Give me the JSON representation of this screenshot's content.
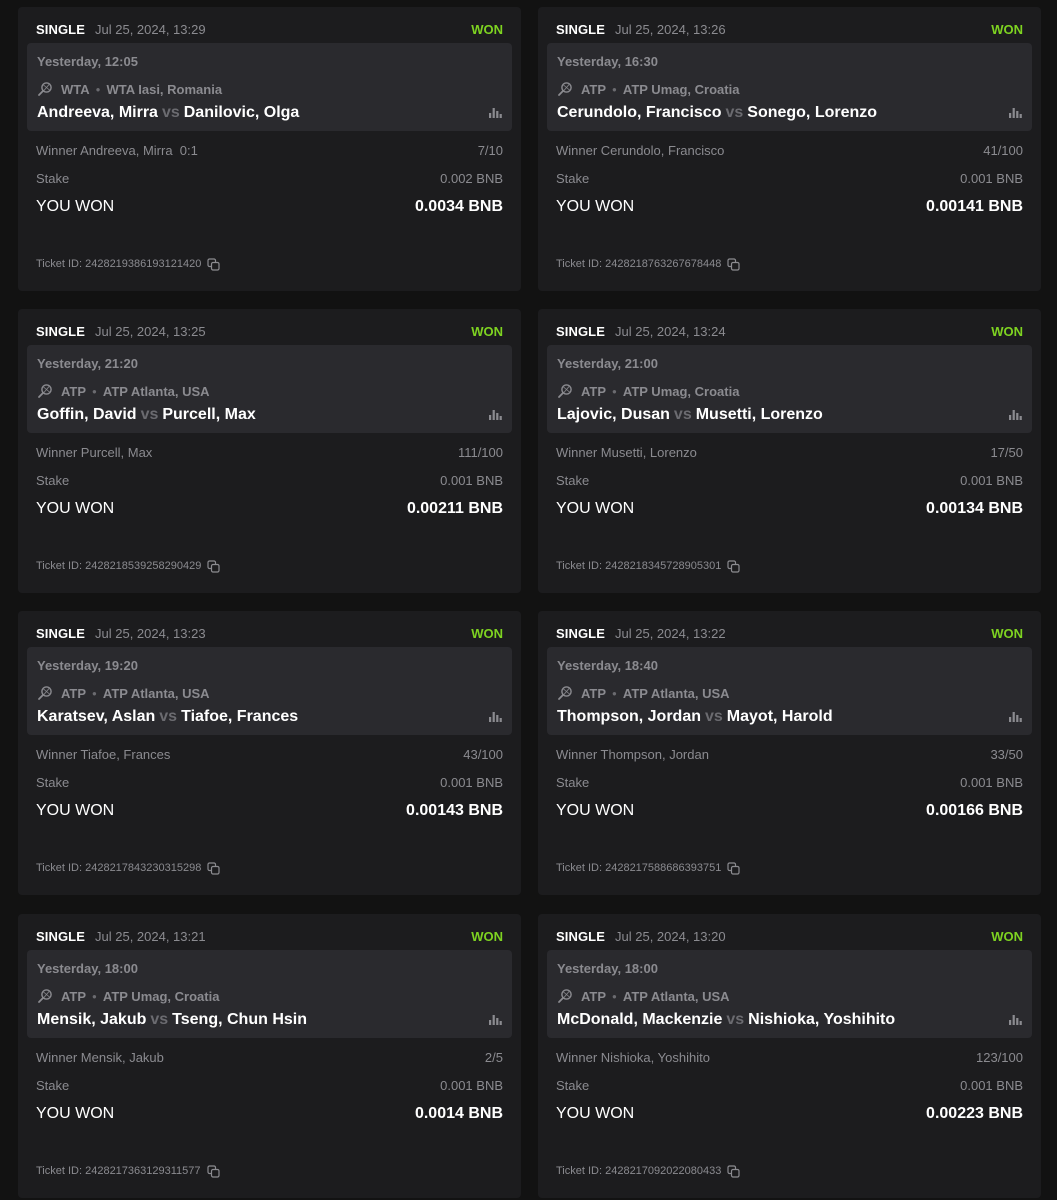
{
  "colors": {
    "won": "#7ed321",
    "muted": "#8b8b90",
    "card_bg": "#1c1c1e",
    "event_bg": "#2a2a2e"
  },
  "tickets": [
    {
      "type": "SINGLE",
      "placed": "Jul 25, 2024, 13:29",
      "status": "WON",
      "event_time": "Yesterday, 12:05",
      "sport_icon": "tennis-racket-icon",
      "tour": "WTA",
      "tournament": "WTA Iasi, Romania",
      "home": "Andreeva, Mirra",
      "vs": "vs",
      "away": "Danilovic, Olga",
      "selection": "Winner Andreeva, Mirra  0:1",
      "odds": "7/10",
      "stake_label": "Stake",
      "stake": "0.002 BNB",
      "won_label": "YOU WON",
      "won": "0.0034 BNB",
      "ticket_id": "Ticket ID: 2428219386193121420"
    },
    {
      "type": "SINGLE",
      "placed": "Jul 25, 2024, 13:26",
      "status": "WON",
      "event_time": "Yesterday, 16:30",
      "sport_icon": "tennis-racket-icon",
      "tour": "ATP",
      "tournament": "ATP Umag, Croatia",
      "home": "Cerundolo, Francisco",
      "vs": "vs",
      "away": "Sonego, Lorenzo",
      "selection": "Winner Cerundolo, Francisco",
      "odds": "41/100",
      "stake_label": "Stake",
      "stake": "0.001 BNB",
      "won_label": "YOU WON",
      "won": "0.00141 BNB",
      "ticket_id": "Ticket ID: 2428218763267678448"
    },
    {
      "type": "SINGLE",
      "placed": "Jul 25, 2024, 13:25",
      "status": "WON",
      "event_time": "Yesterday, 21:20",
      "sport_icon": "tennis-racket-icon",
      "tour": "ATP",
      "tournament": "ATP Atlanta, USA",
      "home": "Goffin, David",
      "vs": "vs",
      "away": "Purcell, Max",
      "selection": "Winner Purcell, Max",
      "odds": "111/100",
      "stake_label": "Stake",
      "stake": "0.001 BNB",
      "won_label": "YOU WON",
      "won": "0.00211 BNB",
      "ticket_id": "Ticket ID: 2428218539258290429"
    },
    {
      "type": "SINGLE",
      "placed": "Jul 25, 2024, 13:24",
      "status": "WON",
      "event_time": "Yesterday, 21:00",
      "sport_icon": "tennis-racket-icon",
      "tour": "ATP",
      "tournament": "ATP Umag, Croatia",
      "home": "Lajovic, Dusan",
      "vs": "vs",
      "away": "Musetti, Lorenzo",
      "selection": "Winner Musetti, Lorenzo",
      "odds": "17/50",
      "stake_label": "Stake",
      "stake": "0.001 BNB",
      "won_label": "YOU WON",
      "won": "0.00134 BNB",
      "ticket_id": "Ticket ID: 2428218345728905301"
    },
    {
      "type": "SINGLE",
      "placed": "Jul 25, 2024, 13:23",
      "status": "WON",
      "event_time": "Yesterday, 19:20",
      "sport_icon": "tennis-racket-icon",
      "tour": "ATP",
      "tournament": "ATP Atlanta, USA",
      "home": "Karatsev, Aslan",
      "vs": "vs",
      "away": "Tiafoe, Frances",
      "selection": "Winner Tiafoe, Frances",
      "odds": "43/100",
      "stake_label": "Stake",
      "stake": "0.001 BNB",
      "won_label": "YOU WON",
      "won": "0.00143 BNB",
      "ticket_id": "Ticket ID: 2428217843230315298"
    },
    {
      "type": "SINGLE",
      "placed": "Jul 25, 2024, 13:22",
      "status": "WON",
      "event_time": "Yesterday, 18:40",
      "sport_icon": "tennis-racket-icon",
      "tour": "ATP",
      "tournament": "ATP Atlanta, USA",
      "home": "Thompson, Jordan",
      "vs": "vs",
      "away": "Mayot, Harold",
      "selection": "Winner Thompson, Jordan",
      "odds": "33/50",
      "stake_label": "Stake",
      "stake": "0.001 BNB",
      "won_label": "YOU WON",
      "won": "0.00166 BNB",
      "ticket_id": "Ticket ID: 2428217588686393751"
    },
    {
      "type": "SINGLE",
      "placed": "Jul 25, 2024, 13:21",
      "status": "WON",
      "event_time": "Yesterday, 18:00",
      "sport_icon": "tennis-racket-icon",
      "tour": "ATP",
      "tournament": "ATP Umag, Croatia",
      "home": "Mensik, Jakub",
      "vs": "vs",
      "away": "Tseng, Chun Hsin",
      "selection": "Winner Mensik, Jakub",
      "odds": "2/5",
      "stake_label": "Stake",
      "stake": "0.001 BNB",
      "won_label": "YOU WON",
      "won": "0.0014 BNB",
      "ticket_id": "Ticket ID: 2428217363129311577"
    },
    {
      "type": "SINGLE",
      "placed": "Jul 25, 2024, 13:20",
      "status": "WON",
      "event_time": "Yesterday, 18:00",
      "sport_icon": "tennis-racket-icon",
      "tour": "ATP",
      "tournament": "ATP Atlanta, USA",
      "home": "McDonald, Mackenzie",
      "vs": "vs",
      "away": "Nishioka, Yoshihito",
      "selection": "Winner Nishioka, Yoshihito",
      "odds": "123/100",
      "stake_label": "Stake",
      "stake": "0.001 BNB",
      "won_label": "YOU WON",
      "won": "0.00223 BNB",
      "ticket_id": "Ticket ID: 2428217092022080433"
    }
  ]
}
